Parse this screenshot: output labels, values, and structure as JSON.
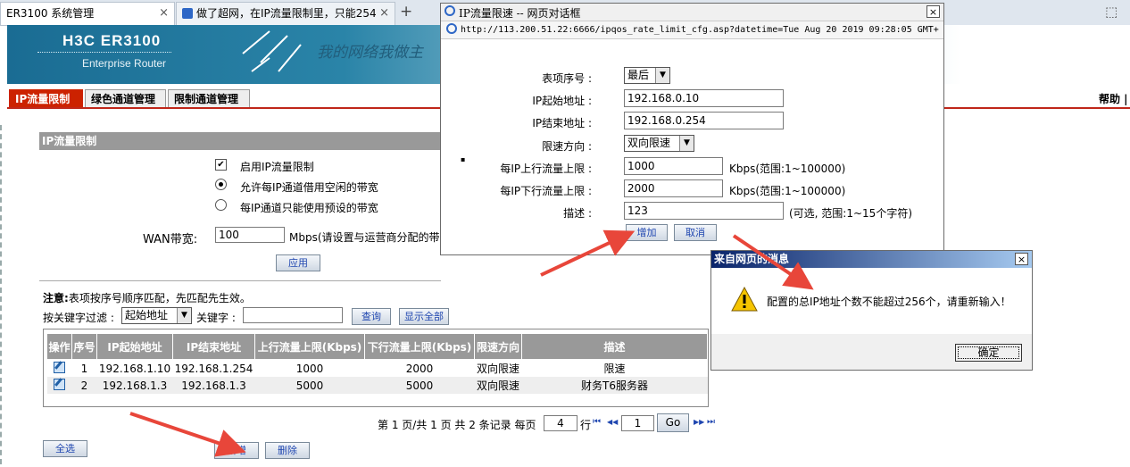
{
  "browser": {
    "tab1_title": "ER3100  系统管理",
    "tab1_close": "×",
    "tab2_title": "做了超网，在IP流量限制里，只能254",
    "tab2_close": "×",
    "new_tab": "+",
    "right_icon": "⬚"
  },
  "banner": {
    "brand": "H3C ER3100",
    "subtitle": "Enterprise Router",
    "slogan": "我的网络我做主"
  },
  "nav": {
    "tabs": [
      "IP流量限制",
      "绿色通道管理",
      "限制通道管理"
    ],
    "help": "帮助 |"
  },
  "section": {
    "title": "IP流量限制",
    "enable_label": "启用IP流量限制",
    "enable_checked": true,
    "allow_borrow_label": "允许每IP通道借用空闲的带宽",
    "fixed_label": "每IP通道只能使用预设的带宽",
    "wan_label": "WAN带宽:",
    "wan_value": "100",
    "wan_unit": "Mbps(请设置与运营商分配的带",
    "apply_button": "应用"
  },
  "filter": {
    "note_bold": "注意:",
    "note_text": "表项按序号顺序匹配，先匹配先生效。",
    "keyword_filter_label": "按关键字过滤 :",
    "filter_select": "起始地址",
    "keyword_label": "关键字 :",
    "keyword_value": "",
    "query_button": "查询",
    "show_all_button": "显示全部"
  },
  "table": {
    "headers": [
      "操作",
      "序号",
      "IP起始地址",
      "IP结束地址",
      "上行流量上限(Kbps)",
      "下行流量上限(Kbps)",
      "限速方向",
      "描述"
    ],
    "rows": [
      [
        "",
        "1",
        "192.168.1.10",
        "192.168.1.254",
        "1000",
        "2000",
        "双向限速",
        "限速"
      ],
      [
        "",
        "2",
        "192.168.1.3",
        "192.168.1.3",
        "5000",
        "5000",
        "双向限速",
        "财务T6服务器"
      ]
    ]
  },
  "pagination": {
    "text": "第 1 页/共 1 页 共 2 条记录 每页",
    "per_page": "4",
    "row_unit": "行",
    "first": "⏮",
    "prev": "◀◀",
    "page_value": "1",
    "go_button": "Go",
    "next": "▶▶",
    "last": "⏭"
  },
  "bottom": {
    "select_all_button": "全选",
    "add_button": "新增",
    "delete_button": "删除"
  },
  "dialog": {
    "title": "IP流量限速 -- 网页对话框",
    "close": "×",
    "url": "http://113.200.51.22:6666/ipqos_rate_limit_cfg.asp?datetime=Tue Aug 20 2019 09:28:05 GMT+",
    "entry_label": "表项序号 :",
    "entry_value": "最后",
    "start_ip_label": "IP起始地址 :",
    "start_ip_value": "192.168.0.10",
    "end_ip_label": "IP结束地址 :",
    "end_ip_value": "192.168.0.254",
    "direction_label": "限速方向 :",
    "direction_value": "双向限速",
    "up_label": "每IP上行流量上限 :",
    "up_value": "1000",
    "up_unit": "Kbps(范围:1~100000)",
    "down_label": "每IP下行流量上限 :",
    "down_value": "2000",
    "down_unit": "Kbps(范围:1~100000)",
    "desc_label": "描述 :",
    "desc_value": "123",
    "desc_hint": "(可选, 范围:1~15个字符)",
    "add_button": "增加",
    "cancel_button": "取消"
  },
  "message": {
    "title": "来自网页的消息",
    "close": "×",
    "text": "配置的总IP地址个数不能超过256个，请重新输入！",
    "ok_button": "确定"
  },
  "colors": {
    "accent_red": "#cc2200",
    "header_gray": "#999999",
    "arrow_red": "#e8463a"
  }
}
